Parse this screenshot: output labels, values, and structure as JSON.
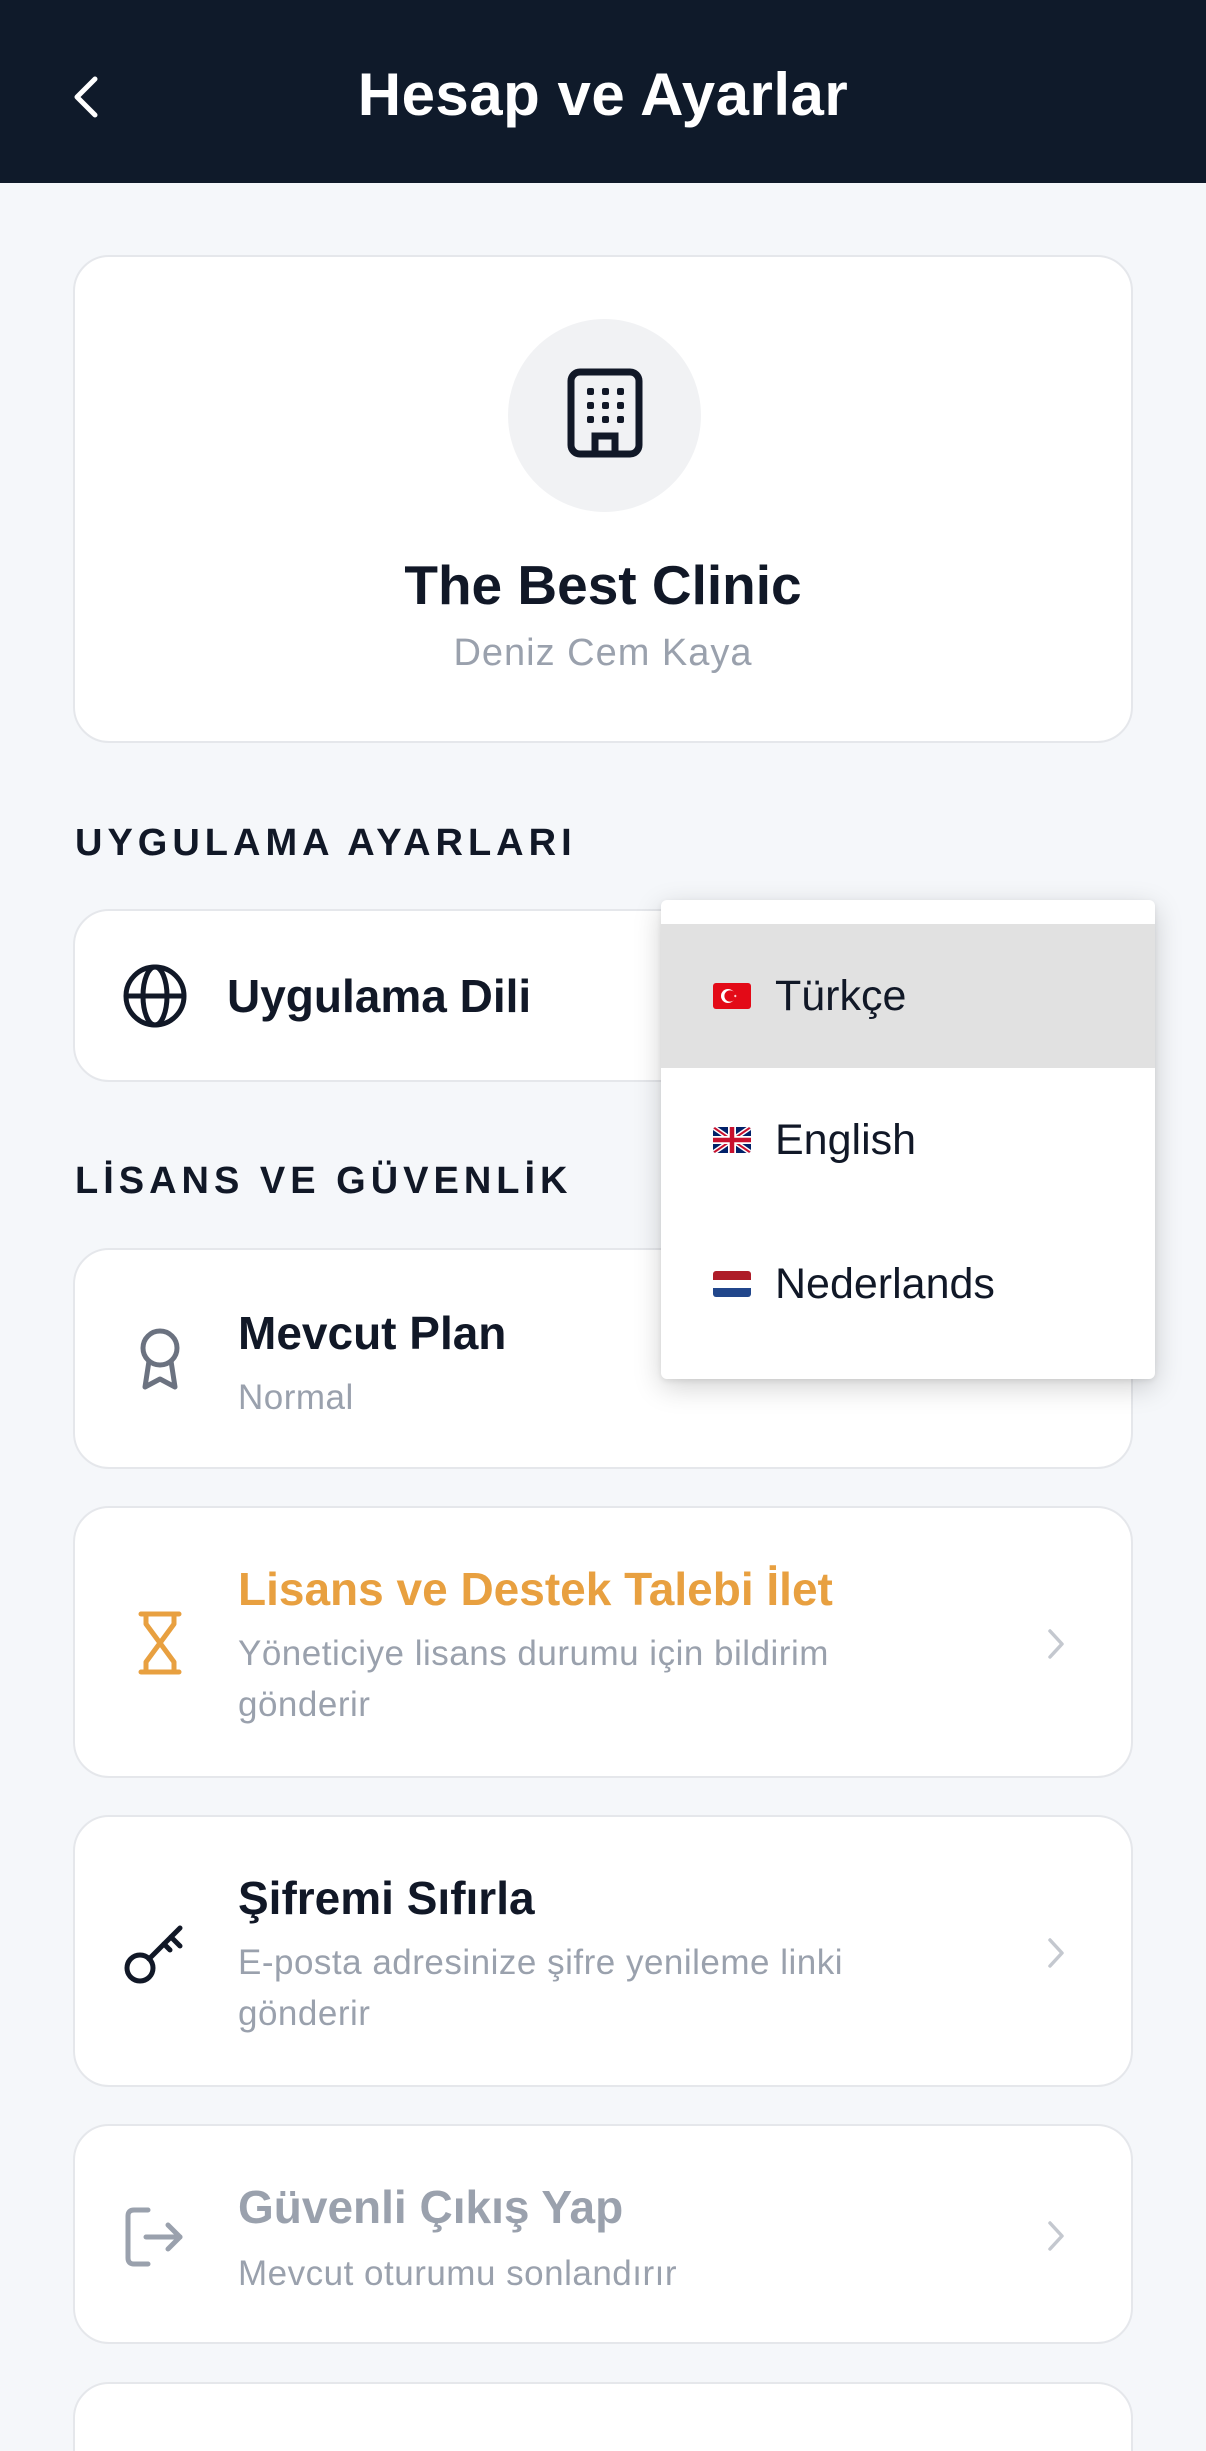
{
  "header": {
    "title": "Hesap ve Ayarlar",
    "back_icon": "chevron-left-icon"
  },
  "profile": {
    "name": "The Best Clinic",
    "user": "Deniz Cem Kaya",
    "icon": "building-icon"
  },
  "sections": {
    "app_settings": "UYGULAMA AYARLARI",
    "license_security": "LİSANS VE GÜVENLİK"
  },
  "app_language": {
    "label": "Uygulama Dili",
    "icon": "globe-icon"
  },
  "plan": {
    "title": "Mevcut Plan",
    "value": "Normal",
    "icon": "award-icon"
  },
  "license_request": {
    "title": "Lisans ve Destek Talebi İlet",
    "subtitle": "Yöneticiye lisans durumu için bildirim gönderir",
    "icon": "hourglass-icon",
    "color": "#e8a040"
  },
  "reset_password": {
    "title": "Şifremi Sıfırla",
    "subtitle": "E-posta adresinize şifre yenileme linki gönderir",
    "icon": "key-icon"
  },
  "logout": {
    "title": "Güvenli Çıkış Yap",
    "subtitle": "Mevcut oturumu sonlandırır",
    "icon": "logout-icon"
  },
  "language_menu": {
    "selected": "Türkçe",
    "options": [
      {
        "label": "Türkçe",
        "flag": "turkey-flag-icon"
      },
      {
        "label": "English",
        "flag": "uk-flag-icon"
      },
      {
        "label": "Nederlands",
        "flag": "netherlands-flag-icon"
      }
    ]
  },
  "colors": {
    "header_bg": "#0f1a2a",
    "page_bg": "#f5f7fa",
    "accent_orange": "#e8a040",
    "muted": "#9aa1ad",
    "danger": "#d83a3a"
  }
}
